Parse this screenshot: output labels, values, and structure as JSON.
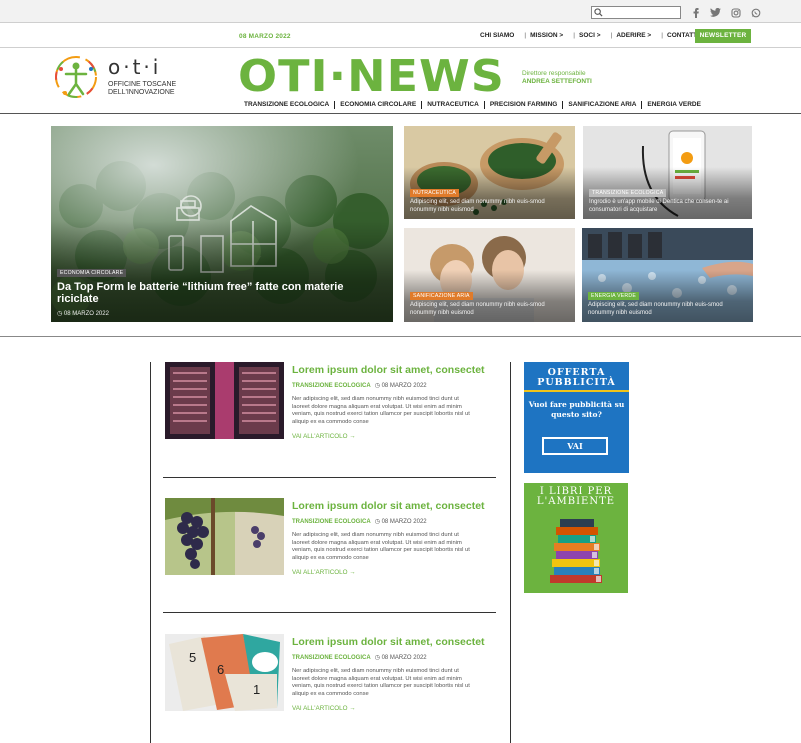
{
  "topbar": {
    "search_placeholder": "",
    "socials": [
      "facebook-icon",
      "twitter-icon",
      "instagram-icon",
      "whatsapp-icon"
    ]
  },
  "nav": {
    "date": "08 MARZO 2022",
    "items": [
      "CHI SIAMO",
      "MISSION >",
      "SOCI >",
      "ADERIRE >",
      "CONTATTI"
    ],
    "newsletter": "NEWSLETTER"
  },
  "header": {
    "logo_name": "o·t·i",
    "logo_sub1": "OFFICINE TOSCANE",
    "logo_sub2": "DELL'INNOVAZIONE",
    "brand": "OTI·NEWS",
    "director_label": "Direttore responsabile",
    "director_name": "ANDREA SETTEFONTI",
    "categories": [
      "TRANSIZIONE ECOLOGICA",
      "ECONOMIA CIRCOLARE",
      "NUTRACEUTICA",
      "PRECISION FARMING",
      "SANIFICAZIONE ARIA",
      "ENERGIA VERDE"
    ]
  },
  "hero": {
    "main": {
      "badge": "ECONOMIA CIRCOLARE",
      "title": "Da Top Form le batterie “lithium free” fatte con materie riciclate",
      "date": "08 MARZO 2022"
    },
    "tiles": [
      {
        "badge": "NUTRACEUTICA",
        "excerpt": "Adipiscing elit, sed diam nonummy nibh euis-smod   nonummy nibh euismod"
      },
      {
        "badge": "TRANSIZIONE ECOLOGICA",
        "excerpt": "Ingrodio è un'app mobile di Dentica che consen-te ai consumatori di acquistare"
      },
      {
        "badge": "SANIFICAZIONE ARIA",
        "excerpt": "Adipiscing elit, sed diam nonummy nibh euis-smod   nonummy nibh euismod"
      },
      {
        "badge": "ENERGIA VERDE",
        "excerpt": "Adipiscing elit, sed diam nonummy nibh euis-smod   nonummy nibh euismod"
      }
    ]
  },
  "articles": [
    {
      "title": "Lorem ipsum dolor sit amet, consectet",
      "category": "TRANSIZIONE ECOLOGICA",
      "date": "08 MARZO 2022",
      "excerpt": "Ner adipiscing elit, sed diam nonummy nibh euismod tinci dunt ut laoreet dolore magna aliquam erat volutpat. Ut wisi enim ad minim veniam, quis nostrud exerci tation ullamcor per suscipit lobortis nisl ut aliquip ex ea commodo conse",
      "more": "VAI ALL'ARTICOLO"
    },
    {
      "title": "Lorem ipsum dolor sit amet, consectet",
      "category": "TRANSIZIONE ECOLOGICA",
      "date": "08 MARZO 2022",
      "excerpt": "Ner adipiscing elit, sed diam nonummy nibh euismod tinci dunt ut laoreet dolore magna aliquam erat volutpat. Ut wisi enim ad minim veniam, quis nostrud exerci tation ullamcor per suscipit lobortis nisl ut aliquip ex ea commodo conse",
      "more": "VAI ALL'ARTICOLO"
    },
    {
      "title": "Lorem ipsum dolor sit amet, consectet",
      "category": "TRANSIZIONE ECOLOGICA",
      "date": "08 MARZO 2022",
      "excerpt": "Ner adipiscing elit, sed diam nonummy nibh euismod tinci dunt ut laoreet dolore magna aliquam erat volutpat. Ut wisi enim ad minim veniam, quis nostrud exerci tation ullamcor per suscipit lobortis nisl ut aliquip ex ea commodo conse",
      "more": "VAI ALL'ARTICOLO"
    }
  ],
  "sidebar": {
    "ad_title_1": "OFFERTA",
    "ad_title_2": "PUBBLICITÀ",
    "ad_text": "Vuoi fare pubblicità su questo sito?",
    "ad_button": "VAI",
    "books_title_1": "I LIBRI PER",
    "books_title_2": "L'AMBIENTE"
  },
  "colors": {
    "accent_green": "#6cb33f",
    "ad_blue": "#1e74c2",
    "ad_gold": "#f0c419",
    "badge_orange": "#e07b2a"
  }
}
